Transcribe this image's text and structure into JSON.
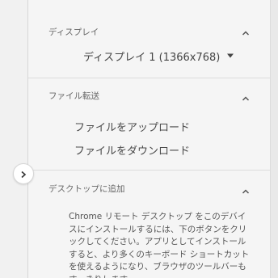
{
  "display": {
    "section_title": "ディスプレイ",
    "selected_display": "ディスプレイ 1 (1366x768)"
  },
  "file_transfer": {
    "section_title": "ファイル転送",
    "upload_label": "ファイルをアップロード",
    "download_label": "ファイルをダウンロード"
  },
  "add_to_desktop": {
    "section_title": "デスクトップに追加",
    "description": "Chrome リモート デスクトップ をこのデバイスにインストールするには、下のボタンをクリックしてください。アプリとしてインストールすると、より多くのキーボード ショートカットを使えるようになり、ブラウザのツールバーもすっきりします。"
  },
  "icons": {
    "collapse": "chevron-up-icon",
    "dropdown": "caret-down-icon",
    "side_toggle": "chevron-right-icon"
  }
}
